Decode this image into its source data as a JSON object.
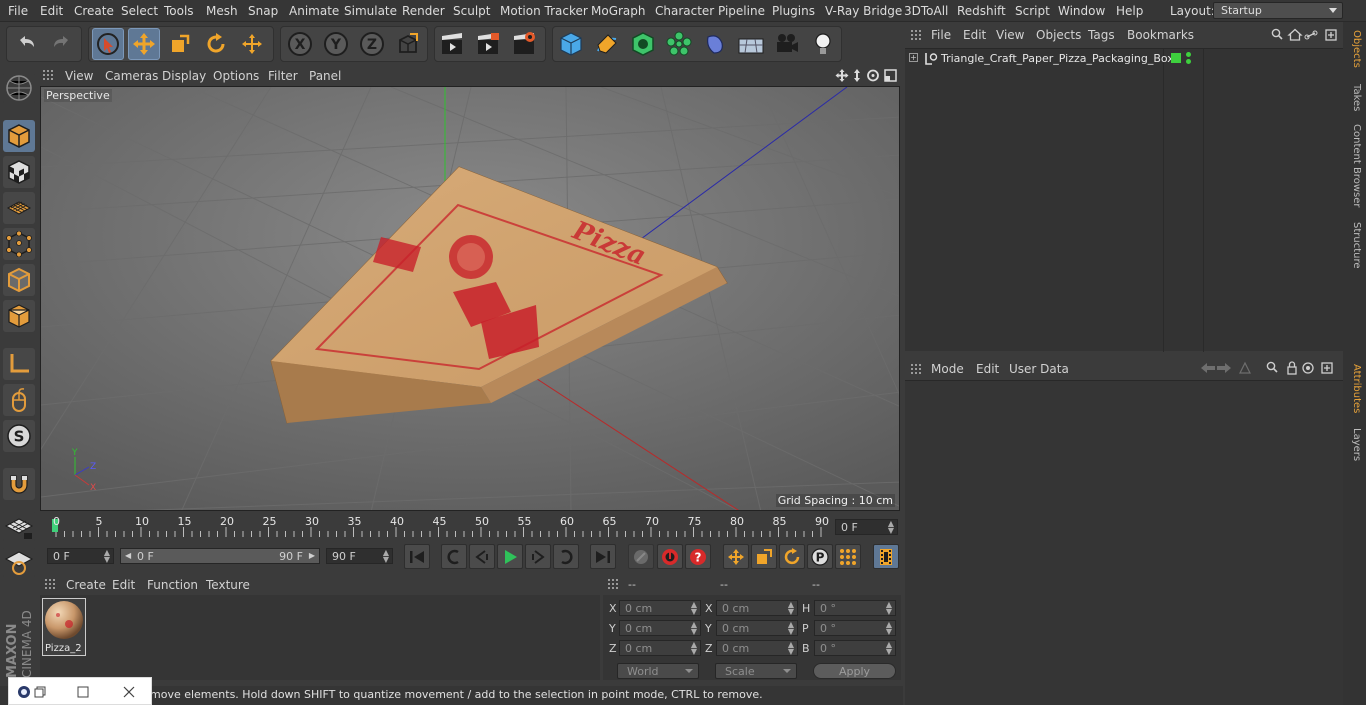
{
  "menubar": {
    "items": [
      "File",
      "Edit",
      "Create",
      "Select",
      "Tools",
      "Mesh",
      "Snap",
      "Animate",
      "Simulate",
      "Render",
      "Sculpt",
      "Motion Tracker",
      "MoGraph",
      "Character",
      "Pipeline",
      "Plugins",
      "V-Ray Bridge",
      "3DToAll",
      "Redshift",
      "Script",
      "Window",
      "Help"
    ],
    "layout_label": "Layout:",
    "layout_value": "Startup"
  },
  "viewport": {
    "menu": [
      "View",
      "Cameras",
      "Display",
      "Options",
      "Filter",
      "Panel"
    ],
    "camera_label": "Perspective",
    "grid_spacing": "Grid Spacing : 10 cm"
  },
  "timeline": {
    "ticks": [
      "0",
      "5",
      "10",
      "15",
      "20",
      "25",
      "30",
      "35",
      "40",
      "45",
      "50",
      "55",
      "60",
      "65",
      "70",
      "75",
      "80",
      "85",
      "90"
    ],
    "current_frame": "0 F",
    "start_field": "0 F",
    "range_start": "0 F",
    "range_end": "90 F",
    "end_field": "90 F"
  },
  "materials": {
    "menu": [
      "Create",
      "Edit",
      "Function",
      "Texture"
    ],
    "items": [
      {
        "name": "Pizza_2"
      }
    ]
  },
  "coordinates": {
    "headers": [
      "--",
      "--",
      "--"
    ],
    "rows": [
      {
        "a_label": "X",
        "a_val": "0 cm",
        "b_label": "X",
        "b_val": "0 cm",
        "c_label": "H",
        "c_val": "0 °"
      },
      {
        "a_label": "Y",
        "a_val": "0 cm",
        "b_label": "Y",
        "b_val": "0 cm",
        "c_label": "P",
        "c_val": "0 °"
      },
      {
        "a_label": "Z",
        "a_val": "0 cm",
        "b_label": "Z",
        "b_val": "0 cm",
        "c_label": "B",
        "c_val": "0 °"
      }
    ],
    "world": "World",
    "scale": "Scale",
    "apply": "Apply"
  },
  "objects": {
    "menu": [
      "File",
      "Edit",
      "View",
      "Objects",
      "Tags",
      "Bookmarks"
    ],
    "items": [
      {
        "name": "Triangle_Craft_Paper_Pizza_Packaging_Box"
      }
    ]
  },
  "attributes": {
    "menu": [
      "Mode",
      "Edit",
      "User Data"
    ]
  },
  "side_tabs": [
    "Objects",
    "Takes",
    "Content Browser",
    "Structure",
    "Attributes",
    "Layers"
  ],
  "brand": {
    "line1": "MAXON",
    "line2": "CINEMA 4D"
  },
  "status": "move elements. Hold down SHIFT to quantize movement / add to the selection in point mode, CTRL to remove.",
  "colors": {
    "accent": "#5f7895",
    "active_tab": "#e8a33a",
    "box": "#c99a66",
    "print": "#c8202a"
  }
}
